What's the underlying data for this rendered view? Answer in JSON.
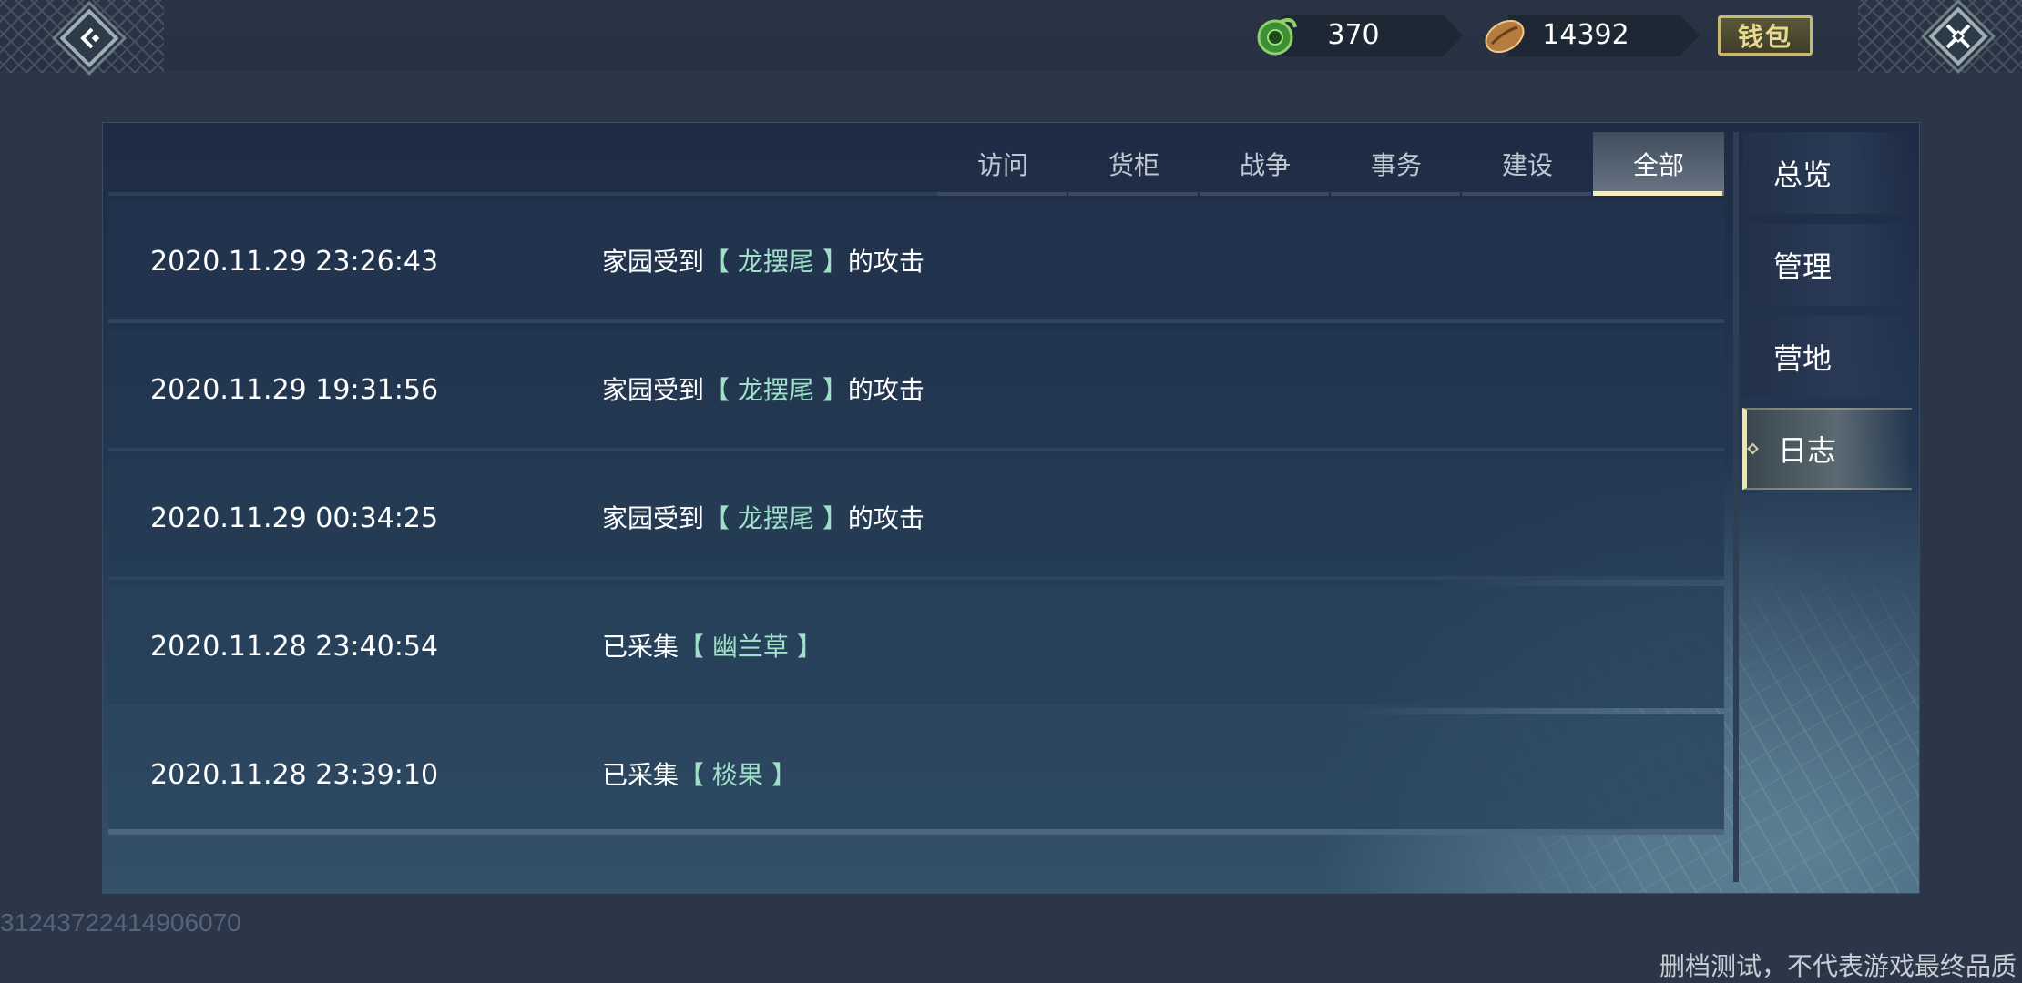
{
  "topbar": {
    "back_icon": "back-arrow-diamond-icon",
    "close_icon": "crossed-swords-close-icon",
    "currencies": [
      {
        "icon": "jade-coin-icon",
        "value": "370",
        "color": "#3f9a3a"
      },
      {
        "icon": "copper-bean-icon",
        "value": "14392",
        "color": "#b07a3c"
      }
    ],
    "wallet_label": "钱包"
  },
  "tabs": [
    {
      "label": "访问",
      "active": false
    },
    {
      "label": "货柜",
      "active": false
    },
    {
      "label": "战争",
      "active": false
    },
    {
      "label": "事务",
      "active": false
    },
    {
      "label": "建设",
      "active": false
    },
    {
      "label": "全部",
      "active": true
    }
  ],
  "logs": [
    {
      "time": "2020.11.29 23:26:43",
      "prefix": "家园受到",
      "target": "【 龙摆尾 】",
      "suffix": "的攻击"
    },
    {
      "time": "2020.11.29 19:31:56",
      "prefix": "家园受到",
      "target": "【 龙摆尾 】",
      "suffix": "的攻击"
    },
    {
      "time": "2020.11.29 00:34:25",
      "prefix": "家园受到",
      "target": "【 龙摆尾 】",
      "suffix": "的攻击"
    },
    {
      "time": "2020.11.28 23:40:54",
      "prefix": "已采集",
      "target": "【 幽兰草 】",
      "suffix": ""
    },
    {
      "time": "2020.11.28 23:39:10",
      "prefix": "已采集",
      "target": "【 棪果 】",
      "suffix": ""
    }
  ],
  "side_nav": [
    {
      "label": "总览",
      "active": false
    },
    {
      "label": "管理",
      "active": false
    },
    {
      "label": "营地",
      "active": false
    },
    {
      "label": "日志",
      "active": true
    }
  ],
  "footer": {
    "build_id": "31243722414906070",
    "disclaimer": "删档测试，不代表游戏最终品质"
  },
  "colors": {
    "highlight_text": "#9fe0c8",
    "active_tab_underline": "#f2ecbf",
    "wallet_gold": "#c9b870"
  }
}
